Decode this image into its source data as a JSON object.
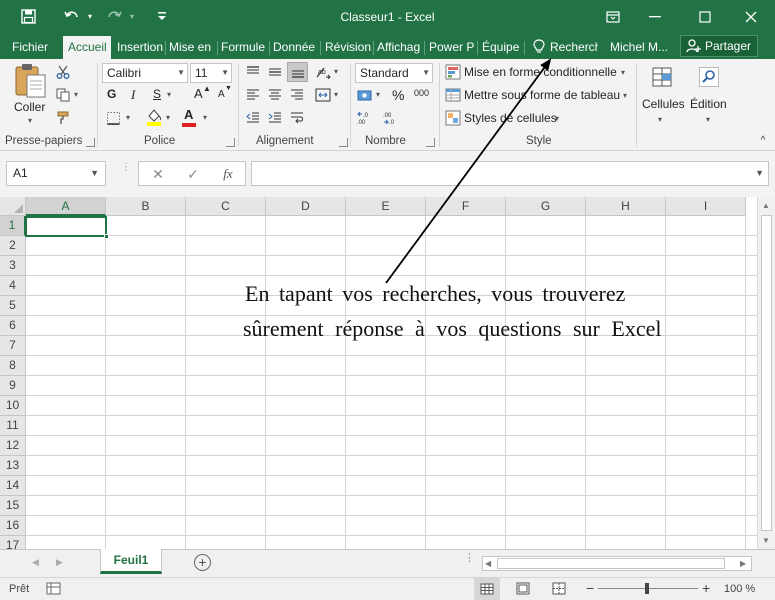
{
  "titlebar": {
    "title": "Classeur1 - Excel",
    "icons": [
      "save-icon",
      "undo-icon",
      "redo-icon",
      "customize-qat-icon",
      "ribbon-display-icon",
      "minimize-icon",
      "maximize-icon",
      "close-icon"
    ]
  },
  "tabs": [
    {
      "label": "Fichier",
      "active": false
    },
    {
      "label": "Accueil",
      "active": true
    },
    {
      "label": "Insertion",
      "active": false
    },
    {
      "label": "Mise en",
      "active": false
    },
    {
      "label": "Formule",
      "active": false
    },
    {
      "label": "Donnée",
      "active": false
    },
    {
      "label": "Révision",
      "active": false
    },
    {
      "label": "Affichag",
      "active": false
    },
    {
      "label": "Power P",
      "active": false
    },
    {
      "label": "Équipe",
      "active": false
    }
  ],
  "tell_me": {
    "label": "Recherch"
  },
  "user": {
    "name": "Michel M..."
  },
  "share": {
    "label": "Partager"
  },
  "ribbon": {
    "clipboard": {
      "paste_label": "Coller",
      "group_label": "Presse-papiers"
    },
    "font": {
      "font_name": "Calibri",
      "font_size": "11",
      "bold": "G",
      "italic": "I",
      "underline": "S",
      "grow": "A",
      "shrink": "A",
      "font_color_letter": "A",
      "group_label": "Police",
      "highlight_color": "#ffff00",
      "font_color": "#e02020"
    },
    "alignment": {
      "group_label": "Alignement"
    },
    "number": {
      "format": "Standard",
      "percent": "%",
      "thousands": "000",
      "group_label": "Nombre"
    },
    "style": {
      "conditional_formatting": "Mise en forme conditionnelle",
      "format_as_table": "Mettre sous forme de tableau",
      "cell_styles": "Styles de cellules",
      "group_label": "Style"
    },
    "cells": {
      "label": "Cellules"
    },
    "editing": {
      "label": "Édition"
    }
  },
  "formula_bar": {
    "name_box": "A1",
    "fx": "fx",
    "formula": ""
  },
  "grid": {
    "columns": [
      "A",
      "B",
      "C",
      "D",
      "E",
      "F",
      "G",
      "H",
      "I"
    ],
    "rows": [
      "1",
      "2",
      "3",
      "4",
      "5",
      "6",
      "7",
      "8",
      "9",
      "10",
      "11",
      "12",
      "13",
      "14",
      "15",
      "16",
      "17"
    ],
    "active_cell": "A1"
  },
  "annotation": {
    "line1": "En tapant vos recherches, vous trouverez",
    "line2": "sûrement réponse à vos questions sur Excel"
  },
  "sheets": [
    {
      "name": "Feuil1",
      "active": true
    }
  ],
  "status": {
    "ready": "Prêt",
    "zoom": "100 %"
  },
  "colors": {
    "excel_green": "#217346",
    "ribbon_bg": "#f3f3f3",
    "header_bg": "#e6e6e6",
    "gridline": "#d4d4d4"
  }
}
